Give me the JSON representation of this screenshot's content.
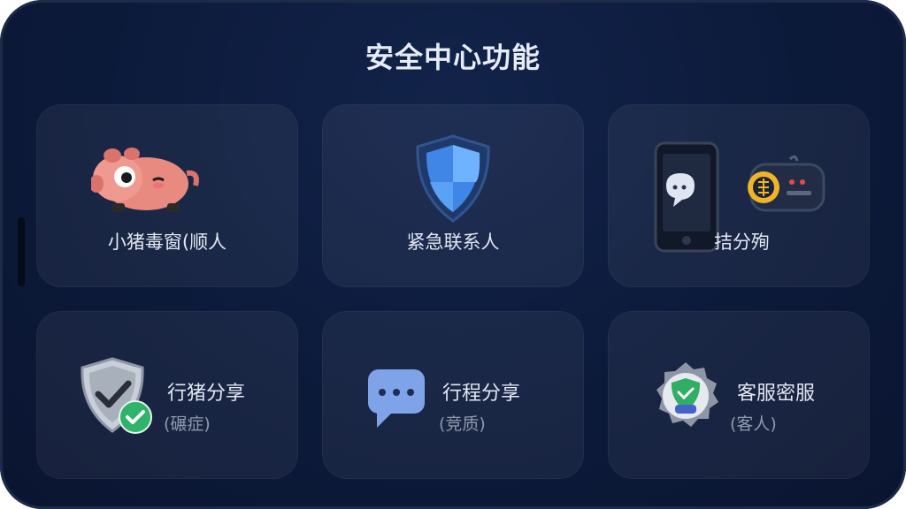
{
  "page": {
    "title": "安全中心功能"
  },
  "cards": [
    {
      "label": "小猪毒窗(顺人",
      "icon": "pig-icon"
    },
    {
      "label": "紧急联系人",
      "icon": "shield-icon"
    },
    {
      "label": "拮分殉",
      "icon": "phone-chat-icon"
    },
    {
      "label": "行猪分享",
      "sub": "(碾症)",
      "icon": "shield-check-icon"
    },
    {
      "label": "行程分享",
      "sub": "(竞质)",
      "icon": "chat-bubble-icon"
    },
    {
      "label": "客服密服",
      "sub": "(客人)",
      "icon": "badge-check-icon"
    }
  ],
  "colors": {
    "background": "#0c1a3a",
    "card": "#1a2745",
    "text": "#e2e7f2",
    "subtext": "#8f99ad"
  }
}
